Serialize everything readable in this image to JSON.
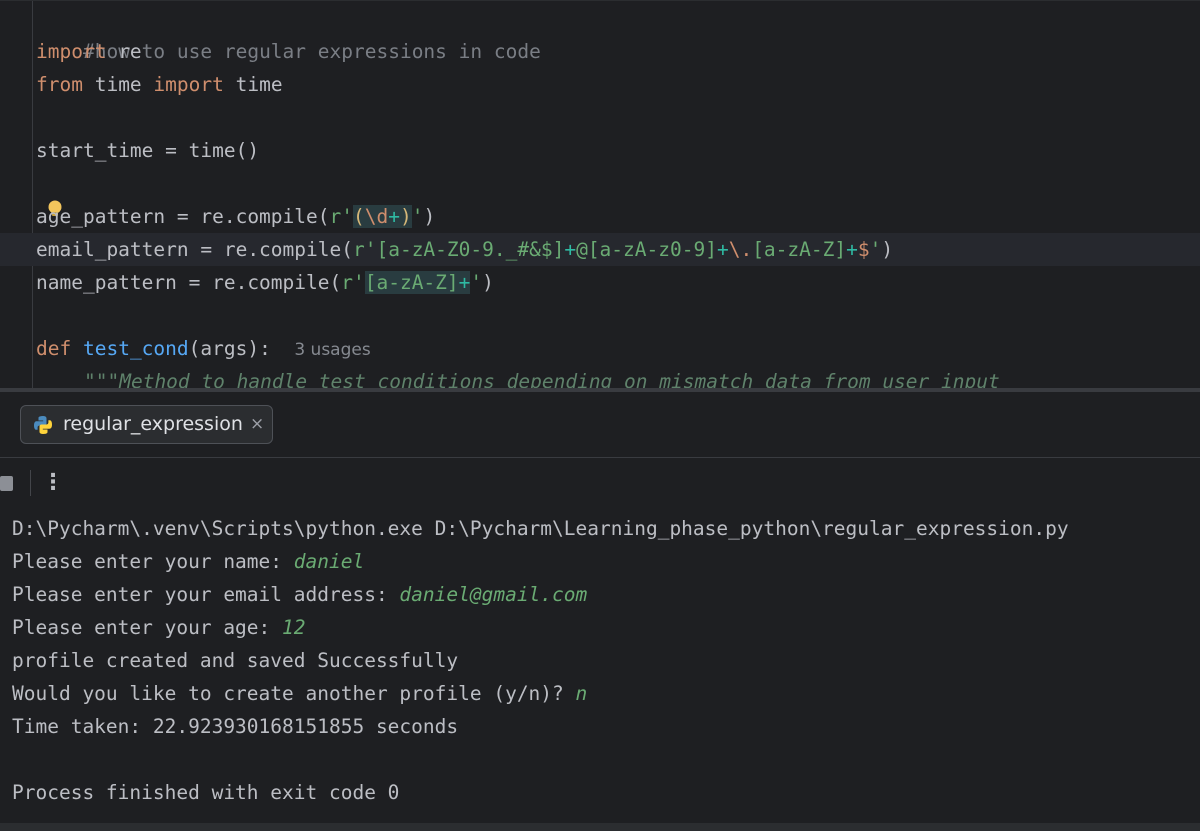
{
  "editor": {
    "comment": "#how to use regular expressions in code",
    "line_import": {
      "kw": "import",
      "rest": " re"
    },
    "line_from": {
      "kw1": "from",
      "mod": " time ",
      "kw2": "import",
      "rest": " time"
    },
    "line_start": "start_time = time()",
    "line_age": {
      "pre": "age_pattern = re.compile(",
      "prefix": "r'",
      "grp_open": "(",
      "esc": "\\d",
      "qnt": "+",
      "grp_close": ")",
      "quote": "'",
      "post": ")"
    },
    "line_email": {
      "pre": "email_pattern = re.compile(",
      "prefix": "r'",
      "cls1": "[a-zA-Z0-9._#&$]",
      "q1": "+",
      "at": "@",
      "cls2": "[a-zA-z0-9]",
      "q2": "+",
      "esc": "\\.",
      "cls3": "[a-zA-Z]",
      "q3": "+",
      "end": "$",
      "quote": "'",
      "post": ")"
    },
    "line_name": {
      "pre": "name_pattern = re.compile(",
      "prefix": "r'",
      "cls": "[a-zA-Z]",
      "qnt": "+",
      "quote": "'",
      "post": ")"
    },
    "line_def": {
      "kw": "def",
      "fn": "test_cond",
      "args": "(args):",
      "hint": "3 usages"
    },
    "docstring": "\"\"\"Method to handle test conditions depending on mismatch data from user input"
  },
  "run_tab": {
    "label": "regular_expression",
    "close": "×"
  },
  "toolbar": {
    "more": "⋮"
  },
  "console": {
    "cmd": "D:\\Pycharm\\.venv\\Scripts\\python.exe D:\\Pycharm\\Learning_phase_python\\regular_expression.py",
    "name_prompt": "Please enter your name: ",
    "name_value": "daniel",
    "email_prompt": "Please enter your email address: ",
    "email_value": "daniel@gmail.com",
    "age_prompt": "Please enter your age: ",
    "age_value": "12",
    "saved": "profile created and saved Successfully",
    "again_prompt": "Would you like to create another profile (y/n)? ",
    "again_value": "n",
    "time_taken": "Time taken: 22.923930168151855 seconds",
    "finished": "Process finished with exit code 0"
  },
  "colors": {
    "background": "#1e1f22",
    "keyword": "#cf8e6d",
    "string": "#6aab73",
    "function": "#56a8f5",
    "comment": "#7a7e85",
    "regex_background": "#293c40"
  },
  "icons": {
    "intention": "lightbulb-icon",
    "tab": "python-icon",
    "close": "close-icon",
    "stop": "stop-icon",
    "more": "more-vertical-icon"
  }
}
